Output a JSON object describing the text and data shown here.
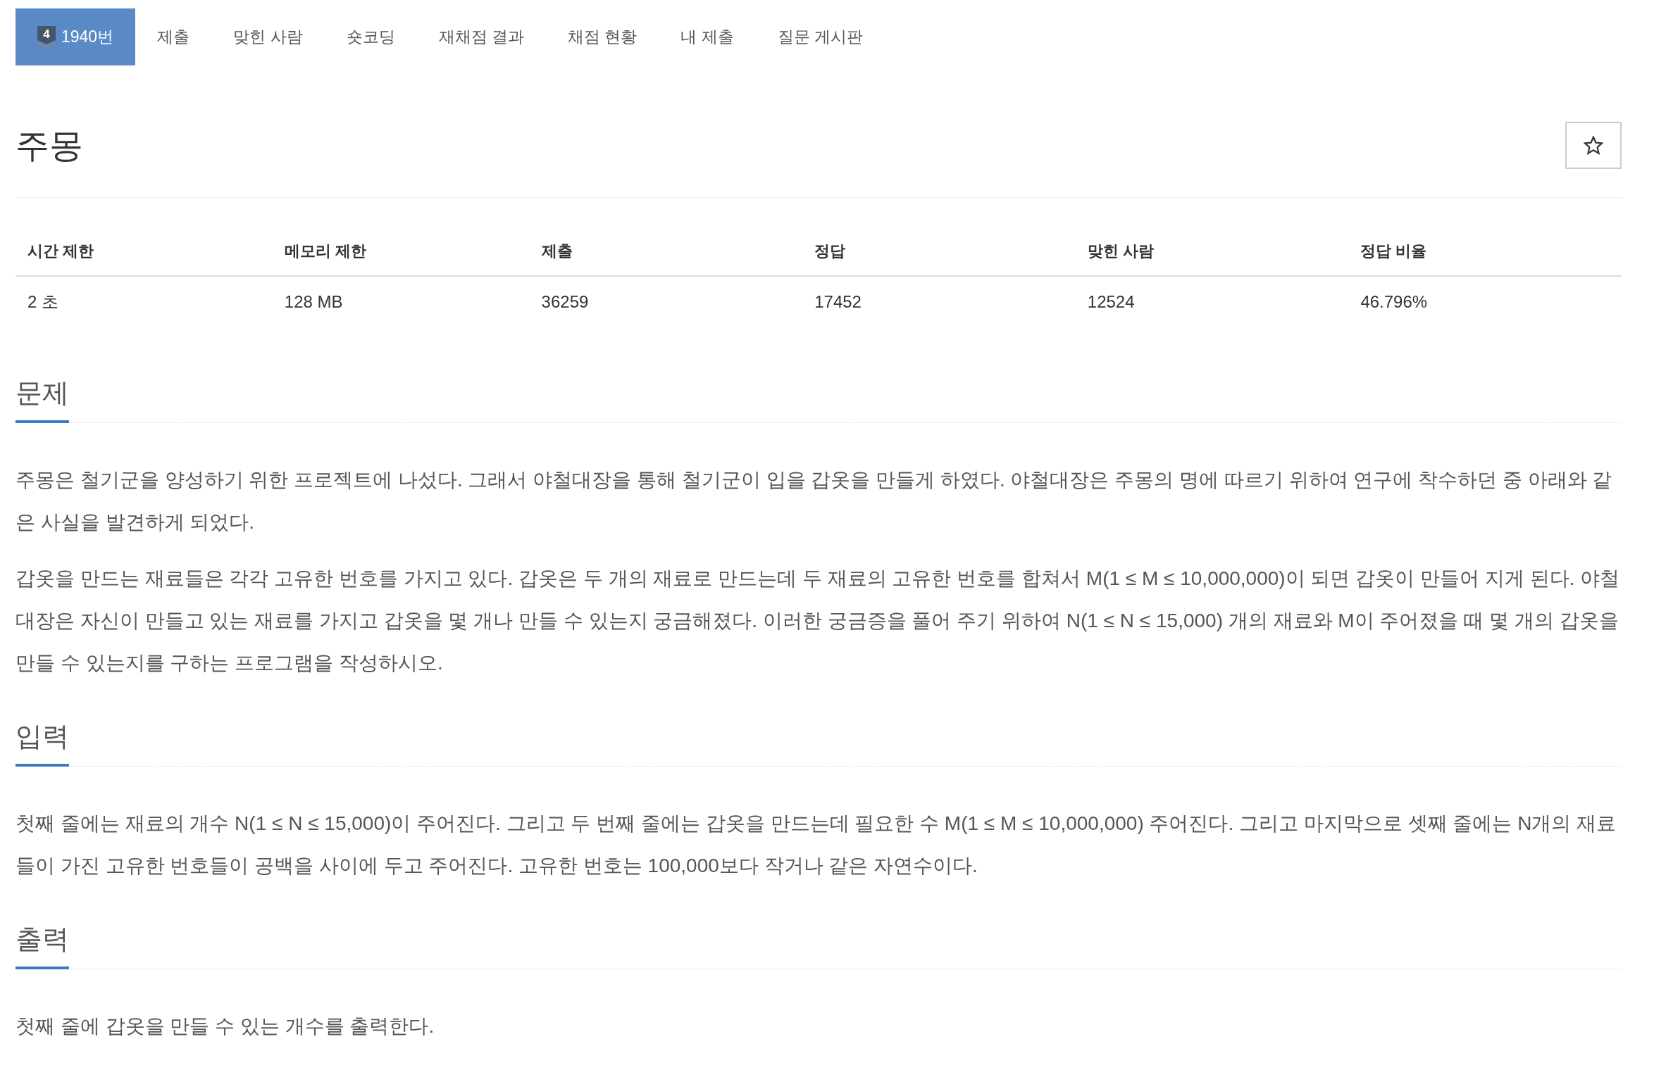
{
  "nav": {
    "tabs": [
      {
        "label": "1940번",
        "tier": "4",
        "selected": true
      },
      {
        "label": "제출",
        "selected": false
      },
      {
        "label": "맞힌 사람",
        "selected": false
      },
      {
        "label": "숏코딩",
        "selected": false
      },
      {
        "label": "재채점 결과",
        "selected": false
      },
      {
        "label": "채점 현황",
        "selected": false
      },
      {
        "label": "내 제출",
        "selected": false
      },
      {
        "label": "질문 게시판",
        "selected": false
      }
    ]
  },
  "problem": {
    "title": "주몽",
    "starred": false
  },
  "info_table": {
    "columns": [
      "시간 제한",
      "메모리 제한",
      "제출",
      "정답",
      "맞힌 사람",
      "정답 비율"
    ],
    "rows": [
      [
        "2 초",
        "128 MB",
        "36259",
        "17452",
        "12524",
        "46.796%"
      ]
    ]
  },
  "sections": [
    {
      "heading": "문제",
      "paragraphs": [
        "주몽은 철기군을 양성하기 위한 프로젝트에 나섰다. 그래서 야철대장을 통해 철기군이 입을 갑옷을 만들게 하였다. 야철대장은 주몽의 명에 따르기 위하여 연구에 착수하던 중 아래와 같은 사실을 발견하게 되었다.",
        "갑옷을 만드는 재료들은 각각 고유한 번호를 가지고 있다. 갑옷은 두 개의 재료로 만드는데 두 재료의 고유한 번호를 합쳐서 M(1 ≤ M ≤ 10,000,000)이 되면 갑옷이 만들어 지게 된다. 야철대장은 자신이 만들고 있는 재료를 가지고 갑옷을 몇 개나 만들 수 있는지 궁금해졌다. 이러한 궁금증을 풀어 주기 위하여 N(1 ≤ N ≤ 15,000) 개의 재료와 M이 주어졌을 때 몇 개의 갑옷을 만들 수 있는지를 구하는 프로그램을 작성하시오."
      ]
    },
    {
      "heading": "입력",
      "paragraphs": [
        "첫째 줄에는 재료의 개수 N(1 ≤ N ≤ 15,000)이 주어진다. 그리고 두 번째 줄에는 갑옷을 만드는데 필요한 수 M(1 ≤ M ≤ 10,000,000) 주어진다. 그리고 마지막으로 셋째 줄에는 N개의 재료들이 가진 고유한 번호들이 공백을 사이에 두고 주어진다. 고유한 번호는 100,000보다 작거나 같은 자연수이다."
      ]
    },
    {
      "heading": "출력",
      "paragraphs": [
        "첫째 줄에 갑옷을 만들 수 있는 개수를 출력한다."
      ]
    }
  ]
}
